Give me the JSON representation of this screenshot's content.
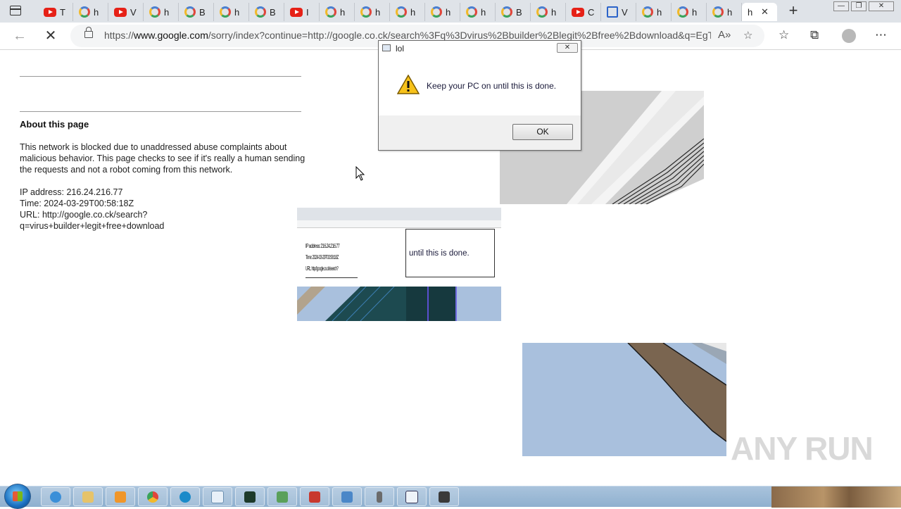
{
  "browser": {
    "tabs": [
      {
        "favicon": "youtube-icon",
        "letter": "T"
      },
      {
        "favicon": "google-icon",
        "letter": "h"
      },
      {
        "favicon": "youtube-icon",
        "letter": "V"
      },
      {
        "favicon": "google-icon",
        "letter": "h"
      },
      {
        "favicon": "google-icon",
        "letter": "B"
      },
      {
        "favicon": "google-icon",
        "letter": "h"
      },
      {
        "favicon": "google-icon",
        "letter": "B"
      },
      {
        "favicon": "youtube-icon",
        "letter": "I"
      },
      {
        "favicon": "google-icon",
        "letter": "h"
      },
      {
        "favicon": "google-icon",
        "letter": "h"
      },
      {
        "favicon": "google-icon",
        "letter": "h"
      },
      {
        "favicon": "google-icon",
        "letter": "h"
      },
      {
        "favicon": "google-icon",
        "letter": "h"
      },
      {
        "favicon": "google-icon",
        "letter": "B"
      },
      {
        "favicon": "google-icon",
        "letter": "h"
      },
      {
        "favicon": "youtube-icon",
        "letter": "C"
      },
      {
        "favicon": "ms-icon",
        "letter": "V"
      },
      {
        "favicon": "google-icon",
        "letter": "h"
      },
      {
        "favicon": "google-icon",
        "letter": "h"
      },
      {
        "favicon": "google-icon",
        "letter": "h"
      },
      {
        "favicon": "none",
        "letter": "h",
        "active": true
      }
    ],
    "address": {
      "prefix": "https://",
      "domain": "www.google.com",
      "rest": "/sorry/index?continue=http://google.co.ck/search%3Fq%3Dvirus%2Bbuilder%2Blegit%2Bfree%2Bdownload&q=EgT..."
    }
  },
  "page": {
    "heading": "About this page",
    "paragraph": "This network is blocked due to unaddressed abuse complaints about malicious behavior. This page checks to see if it's really a human sending the requests and not a robot coming from this network.",
    "ip_line": "IP address: 216.24.216.77",
    "time_line": "Time: 2024-03-29T00:58:18Z",
    "url_line1": "URL: http://google.co.ck/search?",
    "url_line2": "q=virus+builder+legit+free+download"
  },
  "fragment": {
    "text": "until this is done.",
    "ip": "IP address: 216.24.216.77",
    "time": "Time: 2024-03-29T00:58:18Z",
    "url": "URL: http://google.co.ck/search?"
  },
  "dialog": {
    "title": "lol",
    "message": "Keep your PC on until this is done.",
    "ok_label": "OK"
  },
  "watermark": "ANY RUN",
  "colors": {
    "dialog_footer": "#f0f0f0",
    "taskbar": "#a9c3dc",
    "glitch_blue": "#a9c0dd",
    "glitch_brown": "#7a6550"
  }
}
